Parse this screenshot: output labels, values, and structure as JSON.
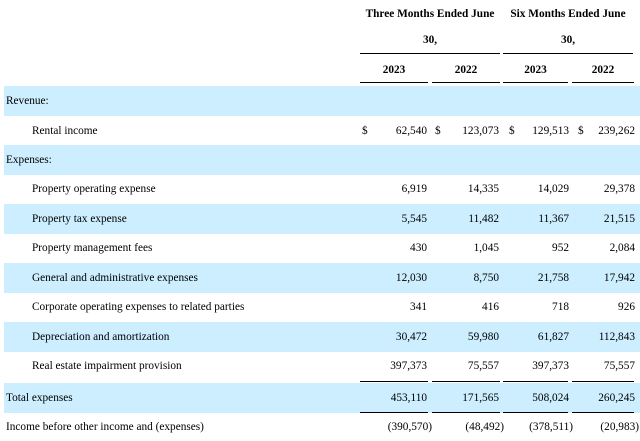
{
  "header": {
    "three_months_line1": "Three Months Ended June",
    "three_months_line2": "30,",
    "six_months_line1": "Six Months Ended June",
    "six_months_line2": "30,",
    "years": [
      "2023",
      "2022",
      "2023",
      "2022"
    ]
  },
  "rows": {
    "revenue_section": {
      "label": "Revenue:"
    },
    "rental_income": {
      "label": "Rental income",
      "currency": "$",
      "values": [
        "62,540",
        "123,073",
        "129,513",
        "239,262"
      ]
    },
    "expenses_section": {
      "label": "Expenses:"
    },
    "property_operating": {
      "label": "Property operating expense",
      "values": [
        "6,919",
        "14,335",
        "14,029",
        "29,378"
      ]
    },
    "property_tax": {
      "label": "Property tax expense",
      "values": [
        "5,545",
        "11,482",
        "11,367",
        "21,515"
      ]
    },
    "property_mgmt": {
      "label": "Property management fees",
      "values": [
        "430",
        "1,045",
        "952",
        "2,084"
      ]
    },
    "general_admin": {
      "label": "General and administrative expenses",
      "values": [
        "12,030",
        "8,750",
        "21,758",
        "17,942"
      ]
    },
    "corporate_related": {
      "label": "Corporate operating expenses to related parties",
      "values": [
        "341",
        "416",
        "718",
        "926"
      ]
    },
    "depreciation": {
      "label": "Depreciation and amortization",
      "values": [
        "30,472",
        "59,980",
        "61,827",
        "112,843"
      ]
    },
    "impairment": {
      "label": "Real estate impairment provision",
      "values": [
        "397,373",
        "75,557",
        "397,373",
        "75,557"
      ]
    },
    "total_expenses": {
      "label": "Total expenses",
      "values": [
        "453,110",
        "171,565",
        "508,024",
        "260,245"
      ]
    },
    "income_before": {
      "label": "Income before other income and (expenses)",
      "values": [
        "(390,570)",
        "(48,492)",
        "(378,511)",
        "(20,983)"
      ]
    }
  }
}
